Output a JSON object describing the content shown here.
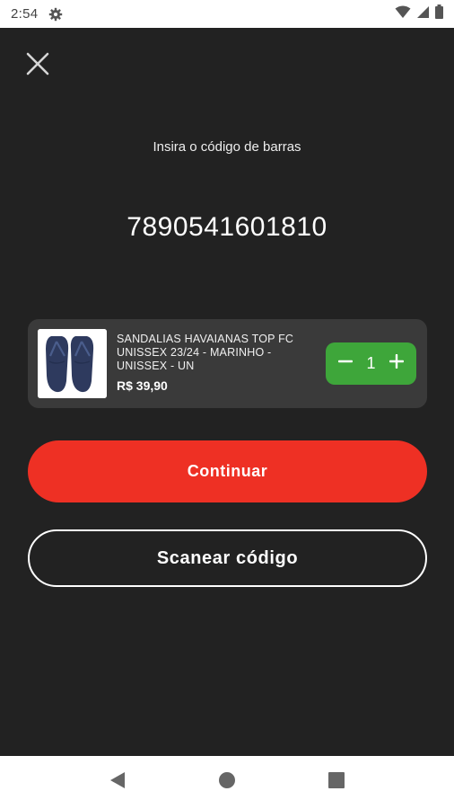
{
  "status_bar": {
    "time": "2:54",
    "icons": [
      "gear-icon",
      "wifi-icon",
      "signal-icon",
      "battery-icon"
    ]
  },
  "header": {
    "close_icon": "close-icon"
  },
  "barcode": {
    "prompt": "Insira o código de barras",
    "value": "7890541601810"
  },
  "product": {
    "name": "SANDALIAS HAVAIANAS TOP FC UNISSEX 23/24 - MARINHO - UNISSEX - UN",
    "price": "R$ 39,90",
    "quantity": "1",
    "thumbnail_icon": "flip-flops-image"
  },
  "actions": {
    "continue_label": "Continuar",
    "scan_label": "Scanear código"
  },
  "nav": {
    "icons": [
      "back-icon",
      "home-icon",
      "recents-icon"
    ]
  },
  "colors": {
    "background": "#222222",
    "card": "#3a3a3a",
    "primary_red": "#ee3024",
    "stepper_green": "#3ea63a"
  }
}
